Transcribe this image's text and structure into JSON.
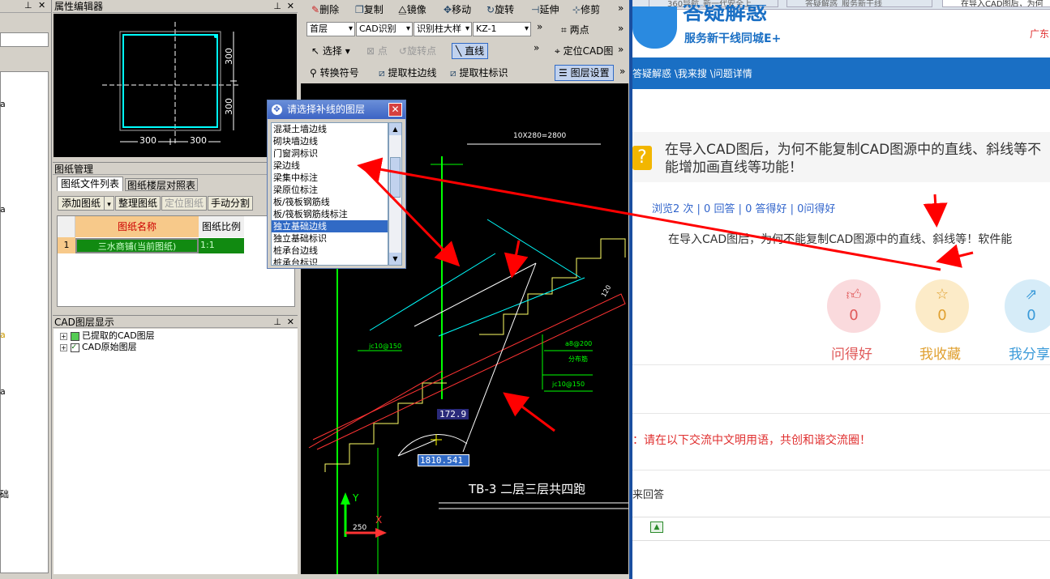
{
  "left_strip": {
    "side_chars": [
      "a",
      "a",
      "a",
      "a"
    ],
    "bottom_label": "础"
  },
  "prop_editor": {
    "title": "属性编辑器",
    "dim_300_right_top": "300",
    "dim_300_right_bottom": "300",
    "dim_300_bottom_left": "300",
    "dim_300_bottom_right": "300"
  },
  "drawing_mgmt": {
    "title": "图纸管理",
    "tabs": [
      "图纸文件列表",
      "图纸楼层对照表"
    ],
    "buttons": [
      "添加图纸",
      "整理图纸",
      "定位图纸",
      "手动分割"
    ],
    "col_name": "图纸名称",
    "col_scale": "图纸比例",
    "row_index": "1",
    "row_name": "三水商铺(当前图纸)",
    "row_scale": "1:1"
  },
  "cad_layers": {
    "title": "CAD图层显示",
    "items": [
      "已提取的CAD图层",
      "CAD原始图层"
    ]
  },
  "toolbar1": {
    "delete": "删除",
    "copy": "复制",
    "mirror": "镜像",
    "move": "移动",
    "rotate": "旋转",
    "extend": "延伸",
    "trim": "修剪"
  },
  "toolbar2": {
    "floor": "首层",
    "cad_recog": "CAD识别",
    "recog_col": "识别柱大样",
    "kz": "KZ-1",
    "two_points": "两点"
  },
  "toolbar3": {
    "select": "选择",
    "point": "点",
    "rotate_point": "旋转点",
    "line": "直线",
    "locate": "定位CAD图"
  },
  "toolbar4": {
    "convert": "转换符号",
    "extract_edge": "提取柱边线",
    "extract_label": "提取柱标识",
    "layer_setting": "图层设置"
  },
  "layer_dialog": {
    "title": "请选择补线的图层",
    "items": [
      "混凝土墙边线",
      "砌块墙边线",
      "门窗洞标识",
      "梁边线",
      "梁集中标注",
      "梁原位标注",
      "板/筏板钢筋线",
      "板/筏板钢筋线标注",
      "独立基础边线",
      "独立基础标识",
      "桩承台边线",
      "桩承台标识"
    ],
    "selected_index": 8
  },
  "cad_canvas": {
    "dim_text": "10X280=2800",
    "tag1": "jc10@150",
    "tag2": "a8@200",
    "tag3": "分布筋",
    "tag4": "jc10@150",
    "dim_120": "120",
    "angle_value": "172.9",
    "length_value": "1810.541",
    "caption": "TB-3 二层三层共四跑",
    "axis_y": "Y",
    "axis_x": "X",
    "axis_250": "250"
  },
  "web": {
    "tabs": [
      "360导航_新一代安全上",
      "答疑解惑_服务新干线",
      "在导入CAD图后，为何"
    ],
    "logo_text": "答疑解惑",
    "logo_sub": "服务新干线同城E+",
    "region": "广东",
    "breadcrumb": "答疑解惑 \\我来搜 \\问题详情",
    "question_title": "在导入CAD图后，为何不能复制CAD图源中的直线、斜线等不能增加画直线等功能！",
    "question_mark": "?",
    "stats": "浏览2 次 | 0 回答 | 0 答得好 | 0问得好",
    "question_body": "在导入CAD图后，为何不能复制CAD图源中的直线、斜线等！软件能",
    "actions": [
      {
        "label": "问得好",
        "count": "0",
        "color": "#e05a5a",
        "bg": "#fadadd"
      },
      {
        "label": "我收藏",
        "count": "0",
        "color": "#e0a030",
        "bg": "#fcebc8"
      },
      {
        "label": "我分享",
        "count": "0",
        "color": "#3a9ad9",
        "bg": "#d6ecf8"
      }
    ],
    "notice": "：请在以下交流中文明用语，共创和谐交流圈！",
    "answer_label": "来回答"
  },
  "colors": {
    "cad_bg": "#000000",
    "green_line": "#00ff00",
    "cyan_line": "#00ffff",
    "arrow_red": "#ff0000",
    "web_blue": "#1a6fc4"
  }
}
